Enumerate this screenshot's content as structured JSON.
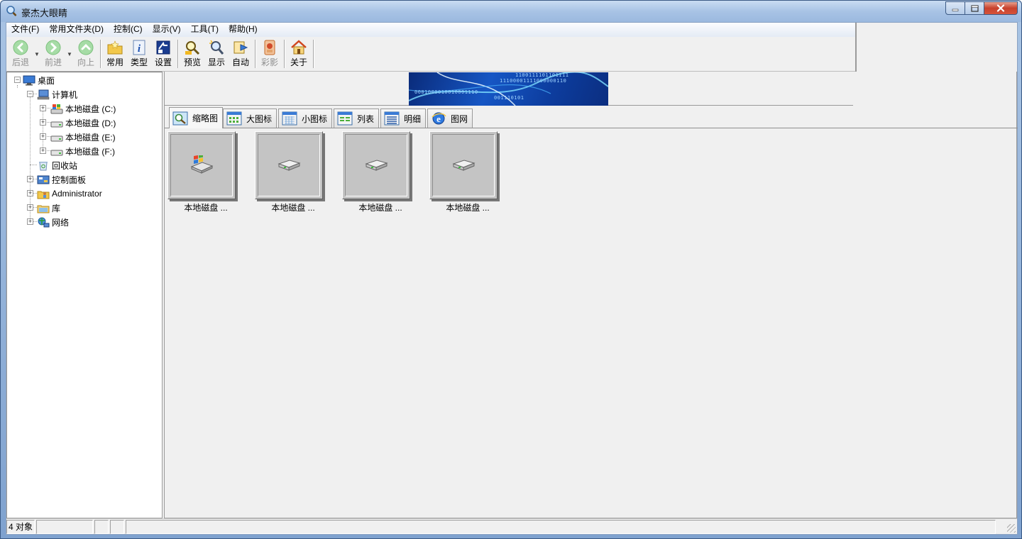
{
  "window": {
    "title": "豪杰大眼睛",
    "app_icon": "magnifier-icon",
    "controls": [
      "minimize",
      "maximize",
      "close"
    ]
  },
  "menu": [
    "文件(F)",
    "常用文件夹(D)",
    "控制(C)",
    "显示(V)",
    "工具(T)",
    "帮助(H)"
  ],
  "toolbar": [
    {
      "id": "back",
      "label": "后退",
      "icon": "back-arrow-icon",
      "enabled": false,
      "dropdown": true
    },
    {
      "id": "forward",
      "label": "前进",
      "icon": "forward-arrow-icon",
      "enabled": false,
      "dropdown": true
    },
    {
      "id": "up",
      "label": "向上",
      "icon": "up-arrow-icon",
      "enabled": false
    },
    {
      "id": "common",
      "label": "常用",
      "icon": "folder-star-icon",
      "enabled": true
    },
    {
      "id": "type",
      "label": "类型",
      "icon": "info-icon",
      "enabled": true
    },
    {
      "id": "settings",
      "label": "设置",
      "icon": "settings-icon",
      "enabled": true
    },
    {
      "id": "preview",
      "label": "预览",
      "icon": "preview-magnifier-icon",
      "enabled": true
    },
    {
      "id": "show",
      "label": "显示",
      "icon": "show-magnifier-icon",
      "enabled": true
    },
    {
      "id": "auto",
      "label": "自动",
      "icon": "auto-slideshow-icon",
      "enabled": true
    },
    {
      "id": "color",
      "label": "彩影",
      "icon": "color-photo-icon",
      "enabled": false
    },
    {
      "id": "about",
      "label": "关于",
      "icon": "home-icon",
      "enabled": true
    }
  ],
  "tree": {
    "desktop": "桌面",
    "computer": "计算机",
    "drives": [
      "本地磁盘 (C:)",
      "本地磁盘 (D:)",
      "本地磁盘 (E:)",
      "本地磁盘 (F:)"
    ],
    "recycle": "回收站",
    "control_panel": "控制面板",
    "user": "Administrator",
    "library": "库",
    "network": "网络"
  },
  "banner": {
    "lines": [
      "0001000010010001110",
      "11100001111000000110",
      "001110101",
      "1100111101101111"
    ]
  },
  "tabs": [
    {
      "label": "缩略图",
      "icon": "thumbnail-view-icon",
      "active": true
    },
    {
      "label": "大图标",
      "icon": "large-icons-view-icon",
      "active": false
    },
    {
      "label": "小图标",
      "icon": "small-icons-view-icon",
      "active": false
    },
    {
      "label": "列表",
      "icon": "list-view-icon",
      "active": false
    },
    {
      "label": "明细",
      "icon": "details-view-icon",
      "active": false
    },
    {
      "label": "图网",
      "icon": "web-gallery-icon",
      "active": false
    }
  ],
  "thumbnails": [
    {
      "caption": "本地磁盘 ...",
      "icon": "system-drive-icon"
    },
    {
      "caption": "本地磁盘 ...",
      "icon": "hard-drive-icon"
    },
    {
      "caption": "本地磁盘 ...",
      "icon": "hard-drive-icon"
    },
    {
      "caption": "本地磁盘 ...",
      "icon": "hard-drive-icon"
    }
  ],
  "status": {
    "count": "4 对象",
    "empty_panels": 4
  },
  "colors": {
    "titlebar": "#a8c3e5",
    "banner": "#1656c4",
    "close": "#c7412c"
  }
}
